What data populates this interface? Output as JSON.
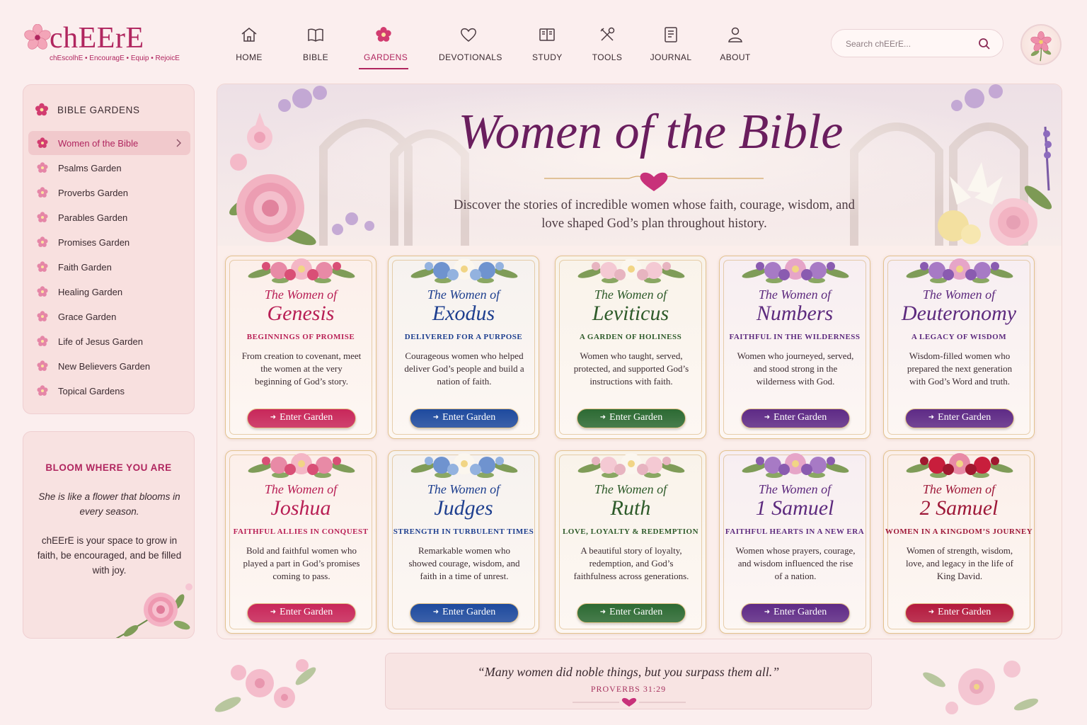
{
  "brand": {
    "name": "chEErE",
    "tagline": "chEscolhE • EncouragE • Equip • RejoicE",
    "accent": "#b0265f"
  },
  "nav": [
    {
      "label": "HOME",
      "icon": "home-icon"
    },
    {
      "label": "BIBLE",
      "icon": "book-icon"
    },
    {
      "label": "GARDENS",
      "icon": "flower-icon",
      "active": true
    },
    {
      "label": "DEVOTIONALS",
      "icon": "heart-icon"
    },
    {
      "label": "STUDY",
      "icon": "open-book-icon"
    },
    {
      "label": "TOOLS",
      "icon": "tools-icon"
    },
    {
      "label": "JOURNAL",
      "icon": "journal-icon"
    },
    {
      "label": "ABOUT",
      "icon": "person-icon"
    }
  ],
  "search": {
    "placeholder": "Search chEErE..."
  },
  "sidebar": {
    "title": "BIBLE GARDENS",
    "items": [
      {
        "label": "Women of the Bible",
        "active": true
      },
      {
        "label": "Psalms Garden"
      },
      {
        "label": "Proverbs Garden"
      },
      {
        "label": "Parables Garden"
      },
      {
        "label": "Promises Garden"
      },
      {
        "label": "Faith Garden"
      },
      {
        "label": "Healing Garden"
      },
      {
        "label": "Grace Garden"
      },
      {
        "label": "Life of Jesus Garden"
      },
      {
        "label": "New Believers Garden"
      },
      {
        "label": "Topical Gardens"
      }
    ]
  },
  "bloom": {
    "title": "BLOOM WHERE YOU ARE",
    "quote": "She is like a flower that blooms in every season.",
    "body": "chEErE is your space to grow in faith, be encouraged, and be filled with joy."
  },
  "hero": {
    "title": "Women of the Bible",
    "subtitle": "Discover the stories of incredible women whose faith, courage, wisdom, and love shaped God’s plan throughout history."
  },
  "cards": [
    {
      "prefix": "The Women of",
      "book": "Genesis",
      "subtitle": "BEGINNINGS OF PROMISE",
      "desc": "From creation to covenant, meet the women at the very beginning of God’s story.",
      "button": "Enter Garden",
      "theme": "rose"
    },
    {
      "prefix": "The Women of",
      "book": "Exodus",
      "subtitle": "DELIVERED FOR A PURPOSE",
      "desc": "Courageous women who helped deliver God’s people and build a nation of faith.",
      "button": "Enter Garden",
      "theme": "blue"
    },
    {
      "prefix": "The Women of",
      "book": "Leviticus",
      "subtitle": "A GARDEN OF HOLINESS",
      "desc": "Women who taught, served, protected, and supported God’s instructions with faith.",
      "button": "Enter Garden",
      "theme": "green"
    },
    {
      "prefix": "The Women of",
      "book": "Numbers",
      "subtitle": "FAITHFUL IN THE WILDERNESS",
      "desc": "Women who journeyed, served, and stood strong in the wilderness with God.",
      "button": "Enter Garden",
      "theme": "purple"
    },
    {
      "prefix": "The Women of",
      "book": "Deuteronomy",
      "subtitle": "A LEGACY OF WISDOM",
      "desc": "Wisdom-filled women who prepared the next generation with God’s Word and truth.",
      "button": "Enter Garden",
      "theme": "purple"
    },
    {
      "prefix": "The Women of",
      "book": "Joshua",
      "subtitle": "FAITHFUL ALLIES IN CONQUEST",
      "desc": "Bold and faithful women who played a part in God’s promises coming to pass.",
      "button": "Enter Garden",
      "theme": "rose"
    },
    {
      "prefix": "The Women of",
      "book": "Judges",
      "subtitle": "STRENGTH IN TURBULENT TIMES",
      "desc": "Remarkable women who showed courage, wisdom, and faith in a time of unrest.",
      "button": "Enter Garden",
      "theme": "blue"
    },
    {
      "prefix": "The Women of",
      "book": "Ruth",
      "subtitle": "LOVE, LOYALTY & REDEMPTION",
      "desc": "A beautiful story of loyalty, redemption, and God’s faithfulness across generations.",
      "button": "Enter Garden",
      "theme": "green"
    },
    {
      "prefix": "The Women of",
      "book": "1 Samuel",
      "subtitle": "FAITHFUL HEARTS IN A NEW ERA",
      "desc": "Women whose prayers, courage, and wisdom influenced the rise of a nation.",
      "button": "Enter Garden",
      "theme": "purple"
    },
    {
      "prefix": "The Women of",
      "book": "2 Samuel",
      "subtitle": "WOMEN IN A KINGDOM’S JOURNEY",
      "desc": "Women of strength, wisdom, love, and legacy in the life of King David.",
      "button": "Enter Garden",
      "theme": "crimson"
    }
  ],
  "themes": {
    "rose": {
      "title": "#b81f55",
      "sub": "#b81f55",
      "btn": "#c8275a",
      "bg": "#fcefea",
      "flowers": [
        "#e88aa6",
        "#f4b6c5",
        "#d94f76"
      ]
    },
    "blue": {
      "title": "#1e3f8f",
      "sub": "#1e3f8f",
      "btn": "#1e4a9e",
      "bg": "#f6f2ef",
      "flowers": [
        "#6f93cf",
        "#fbf6ee",
        "#93b2df"
      ]
    },
    "green": {
      "title": "#2e5b2a",
      "sub": "#2e5b2a",
      "btn": "#2c6a33",
      "bg": "#f9f3ea",
      "flowers": [
        "#f4c9d3",
        "#fbf6ee",
        "#e7b4c0"
      ]
    },
    "purple": {
      "title": "#5d2a7e",
      "sub": "#5d2a7e",
      "btn": "#5e2a86",
      "bg": "#f7eef2",
      "flowers": [
        "#a77ac5",
        "#e6a5c8",
        "#8a5bb0"
      ]
    },
    "crimson": {
      "title": "#9e1838",
      "sub": "#9e1838",
      "btn": "#b3193d",
      "bg": "#fbefea",
      "flowers": [
        "#c81e3c",
        "#e88aa6",
        "#a0182f"
      ]
    }
  },
  "footer": {
    "quote": "“Many women did noble things, but you surpass them all.”",
    "reference": "PROVERBS 31:29"
  }
}
